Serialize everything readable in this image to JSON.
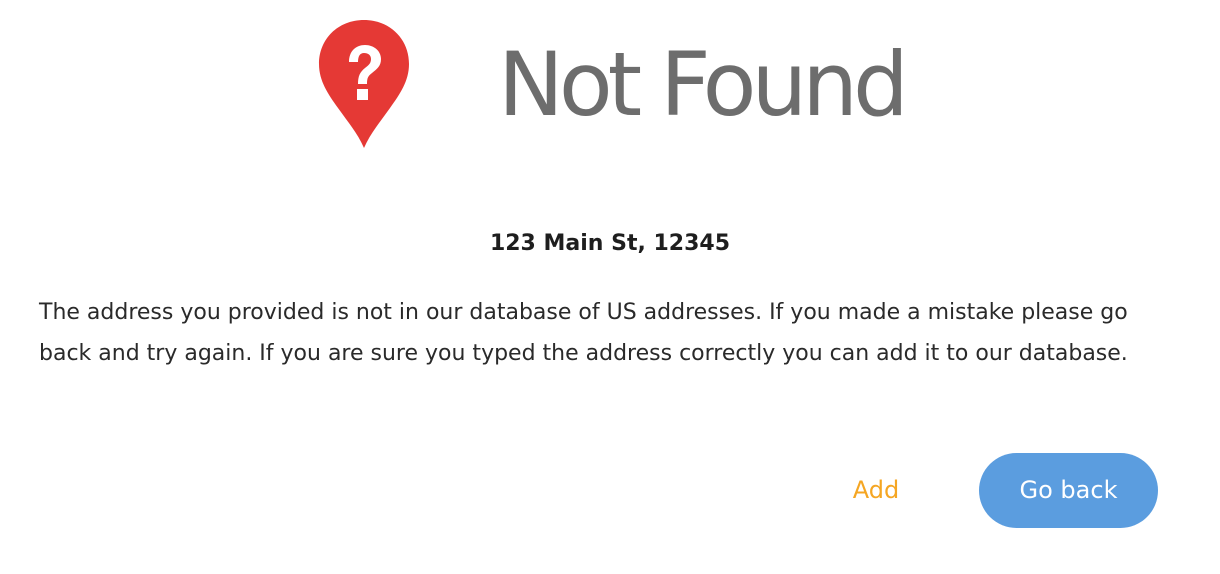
{
  "header": {
    "icon": "map-pin-question-icon",
    "title": "Not Found"
  },
  "address": "123 Main St, 12345",
  "message": "The address you provided is not in our database of US addresses. If you made a mistake please go back and try again. If you are sure you typed the address correctly you can add it to our database.",
  "actions": {
    "add_label": "Add",
    "go_back_label": "Go back"
  },
  "colors": {
    "pin": "#e53935",
    "title": "#6d6d6d",
    "add": "#f5a623",
    "go_back_bg": "#5b9ddf",
    "go_back_text": "#ffffff"
  }
}
